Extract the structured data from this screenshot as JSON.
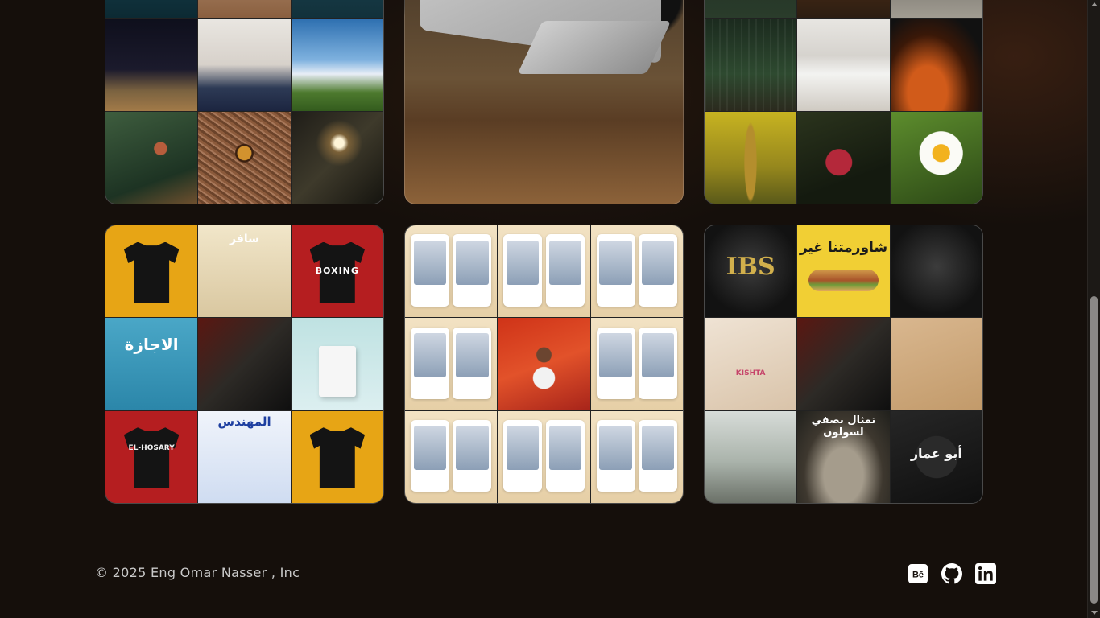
{
  "gallery": {
    "projects": [
      {
        "name": "photography-collage-1"
      },
      {
        "name": "cat-laptop-gif"
      },
      {
        "name": "photography-collage-2"
      },
      {
        "name": "design-collage-1"
      },
      {
        "name": "before-after-retouch"
      },
      {
        "name": "design-collage-2"
      }
    ],
    "design_text": {
      "boxing": "BOXING",
      "hosary": "EL-HOSARY",
      "safer": "سافر",
      "lagaza": "الاجازة",
      "mohandes": "المهندس",
      "ibs": "IBS",
      "kishta": "KISHTA",
      "shawarma": "شاورمتنا غير",
      "statue": "تمثال نصفي لسولون",
      "abuamar": "أبو عمار"
    }
  },
  "footer": {
    "copyright": "© 2025 Eng Omar Nasser , Inc",
    "socials": [
      {
        "name": "behance",
        "icon": "behance-icon",
        "color": "#ffffff"
      },
      {
        "name": "github",
        "icon": "github-icon",
        "color": "#ffffff"
      },
      {
        "name": "linkedin",
        "icon": "linkedin-icon",
        "color": "#ffffff"
      }
    ]
  },
  "colors": {
    "background": "#150f0b",
    "divider": "#4b4744",
    "footer_text": "#c9c9c9"
  }
}
